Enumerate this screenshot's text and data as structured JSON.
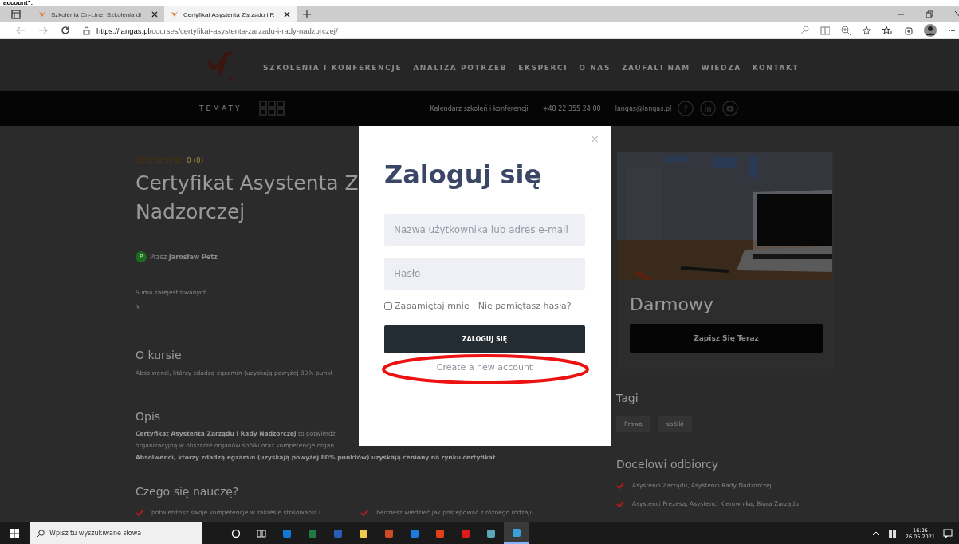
{
  "caption": "account”.",
  "browser": {
    "tabs": [
      {
        "title": "Szkolenia On-Line, Szkolenia dl",
        "selected": false
      },
      {
        "title": "Certyfikat Asystenta Zarządu i R",
        "selected": true
      }
    ],
    "url_host": "https://langas.pl",
    "url_path": "/courses/certyfikat-asystenta-zarzadu-i-rady-nadzorczej/"
  },
  "site": {
    "nav": [
      "SZKOLENIA I KONFERENCJE",
      "ANALIZA POTRZEB",
      "EKSPERCI",
      "O NAS",
      "ZAUFALI NAM",
      "WIEDZA",
      "KONTAKT"
    ],
    "topics_label": "TEMATY",
    "contact": [
      "Kalendarz szkoleń i konferencji",
      "+48 22 355 24 00",
      "langas@langas.pl"
    ]
  },
  "course": {
    "stars": 0,
    "rating": "0 (0)",
    "title_lines": [
      "Certyfikat Asystenta Z",
      "Nadzorczej"
    ],
    "author_initial": "P",
    "author": "Przez **Jarosław Petz**",
    "enrolled_label": "Suma zarejestrowanych",
    "enrolled_value": "3",
    "about_heading": "O kursie",
    "about_text": "Absolwenci, którzy zdadzą egzamin (uzyskają powyżej 80% punkt",
    "desc_heading": "Opis",
    "desc_lines": [
      "**Certyfikat Asystenta Zarządu i Rady Nadzorczej** to potwierdz",
      "organizacyjną w obszarze organów spółki oraz kompetencje organ",
      "**Absolwenci, którzy zdadzą egzamin (uzyskają powyżej 80% punktów) uzyskają ceniony na rynku certyfikat**."
    ],
    "learn_heading": "Czego się nauczę?",
    "learn_items": [
      "potwierdzisz swoje kompetencje w zakresie stosowania i",
      "będziesz wiedzieć jak postępować z różnego rodzaju"
    ],
    "price": "Darmowy",
    "enroll_button": "Zapisz Się Teraz",
    "tags_heading": "Tagi",
    "tags": [
      "Prawo",
      "spółki"
    ],
    "audience_heading": "Docelowi odbiorcy",
    "audience": [
      "Asystenci Zarządu, Asystenci Rady Nadzorczej",
      "Asystenci Prezesa, Asystenci Kierownika, Biura Zarządu"
    ]
  },
  "login": {
    "close": "×",
    "title": "Zaloguj się",
    "username": {
      "placeholder": "Nazwa użytkownika lub adres e-mail"
    },
    "password": {
      "placeholder": "Hasło"
    },
    "remember": {
      "label": "Zapamiętaj mnie",
      "checked": false
    },
    "forgot": "Nie pamiętasz hasła?",
    "submit": "ZALOGUJ SIĘ",
    "register": "Create a new account",
    "register_highlighted": true
  },
  "taskbar": {
    "search": {
      "placeholder": "Wpisz tu wyszukiwane słowa"
    },
    "apps": [
      {
        "selected": false
      },
      {
        "selected": false
      },
      {
        "selected": false
      },
      {
        "selected": false
      },
      {
        "selected": false
      },
      {
        "selected": false
      },
      {
        "selected": false
      },
      {
        "selected": false
      },
      {
        "selected": false
      },
      {
        "selected": false
      },
      {
        "selected": false
      },
      {
        "selected": true
      }
    ],
    "time": "16:06",
    "date": "26.05.2021"
  }
}
